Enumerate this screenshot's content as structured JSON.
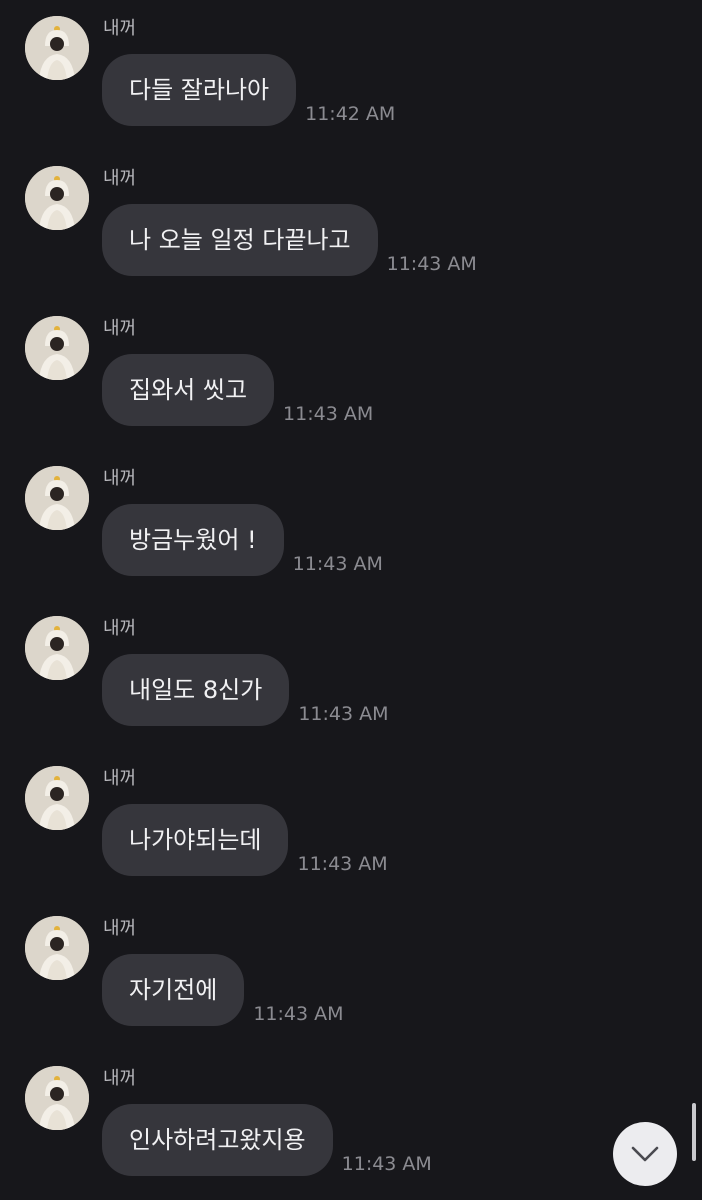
{
  "messages": [
    {
      "sender": "내꺼",
      "text": "다들 잘라나아",
      "time": "11:42 AM"
    },
    {
      "sender": "내꺼",
      "text": "나 오늘 일정 다끝나고",
      "time": "11:43 AM"
    },
    {
      "sender": "내꺼",
      "text": "집와서 씻고",
      "time": "11:43 AM"
    },
    {
      "sender": "내꺼",
      "text": "방금누웠어 !",
      "time": "11:43 AM"
    },
    {
      "sender": "내꺼",
      "text": "내일도 8신가",
      "time": "11:43 AM"
    },
    {
      "sender": "내꺼",
      "text": "나가야되는데",
      "time": "11:43 AM"
    },
    {
      "sender": "내꺼",
      "text": "자기전에",
      "time": "11:43 AM"
    },
    {
      "sender": "내꺼",
      "text": "인사하려고왔지용",
      "time": "11:43 AM"
    }
  ],
  "icons": {
    "avatar": "profile-photo",
    "scroll_down": "chevron-down-icon"
  },
  "colors": {
    "background": "#17171b",
    "bubble": "#36363c",
    "bubble_text": "#f1f1f3",
    "time_text": "#8b8b91",
    "sender_text": "#b6b6bb",
    "scroll_button": "#ececef"
  }
}
